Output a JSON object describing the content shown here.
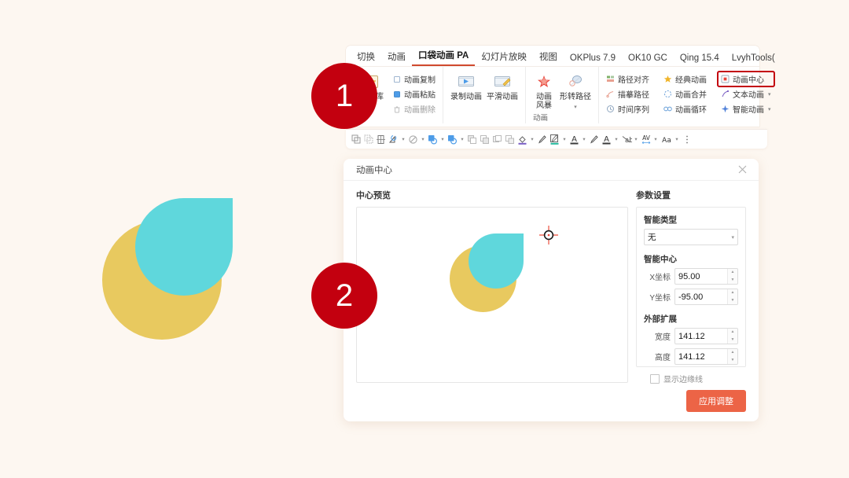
{
  "canvas": {
    "background_color": "#fdf7f1",
    "shapes": [
      {
        "name": "yellow-circle",
        "color": "#e8c95f",
        "type": "circle"
      },
      {
        "name": "cyan-teardrop",
        "color": "#5fd7dc",
        "type": "teardrop"
      }
    ]
  },
  "steps": [
    {
      "number": "1"
    },
    {
      "number": "2"
    }
  ],
  "ribbon": {
    "tabs": [
      {
        "label": "切换",
        "active": false
      },
      {
        "label": "动画",
        "active": false
      },
      {
        "label": "口袋动画 PA",
        "active": true
      },
      {
        "label": "幻灯片放映",
        "active": false
      },
      {
        "label": "视图",
        "active": false
      },
      {
        "label": "OKPlus 7.9",
        "active": false
      },
      {
        "label": "OK10 GC",
        "active": false
      },
      {
        "label": "Qing 15.4",
        "active": false
      },
      {
        "label": "LvyhTools(",
        "active": false
      }
    ],
    "group_title": "动画",
    "groups": [
      {
        "big_buttons": [
          {
            "label": "动画库",
            "icon": "animation-library-icon"
          }
        ],
        "items": [
          {
            "label": "动画复制",
            "icon": "copy-icon",
            "dim": false,
            "caret": false
          },
          {
            "label": "动画粘贴",
            "icon": "paste-icon",
            "dim": false,
            "caret": false
          },
          {
            "label": "动画删除",
            "icon": "delete-icon",
            "dim": true,
            "caret": false
          }
        ]
      },
      {
        "big_buttons": [
          {
            "label": "录制动画",
            "icon": "record-animation-icon"
          },
          {
            "label": "平滑动画",
            "icon": "smooth-animation-icon"
          }
        ],
        "items": []
      },
      {
        "big_buttons": [
          {
            "label": "动画\n风暴",
            "icon": "animation-storm-icon"
          },
          {
            "label": "形转路径",
            "icon": "shape-to-path-icon",
            "caret": true
          }
        ],
        "items": []
      },
      {
        "big_buttons": [],
        "items": [
          {
            "label": "路径对齐",
            "icon": "path-align-icon",
            "dim": false,
            "caret": false
          },
          {
            "label": "描摹路径",
            "icon": "trace-path-icon",
            "dim": false,
            "caret": false
          },
          {
            "label": "时间序列",
            "icon": "time-sequence-icon",
            "dim": false,
            "caret": false
          }
        ]
      },
      {
        "big_buttons": [],
        "items": [
          {
            "label": "经典动画",
            "icon": "classic-animation-icon",
            "dim": false,
            "caret": false
          },
          {
            "label": "动画合并",
            "icon": "merge-animation-icon",
            "dim": false,
            "caret": false
          },
          {
            "label": "动画循环",
            "icon": "loop-animation-icon",
            "dim": false,
            "caret": false
          }
        ]
      },
      {
        "big_buttons": [],
        "items": [
          {
            "label": "动画中心",
            "icon": "animation-center-icon",
            "dim": false,
            "caret": false,
            "highlight": true
          },
          {
            "label": "文本动画",
            "icon": "text-animation-icon",
            "dim": false,
            "caret": true
          },
          {
            "label": "智能动画",
            "icon": "smart-animation-icon",
            "dim": false,
            "caret": true
          }
        ]
      }
    ],
    "strip_icons": [
      {
        "name": "combine-shapes-icon",
        "caret": false
      },
      {
        "name": "split-shapes-icon",
        "caret": false
      },
      {
        "name": "align-objects-icon",
        "caret": false
      },
      {
        "name": "rotate-shape-icon",
        "caret": true
      },
      {
        "name": "no-fill-icon",
        "caret": true
      },
      {
        "name": "shape-fill-blue-icon",
        "caret": true
      },
      {
        "name": "shape-outline-blue-icon",
        "caret": true
      },
      {
        "name": "bring-forward-icon",
        "caret": false
      },
      {
        "name": "send-backward-icon",
        "caret": false
      },
      {
        "name": "bring-to-front-icon",
        "caret": false
      },
      {
        "name": "send-to-back-icon",
        "caret": false
      },
      {
        "name": "fill-color-purple-icon",
        "caret": true
      },
      {
        "name": "format-painter-icon",
        "caret": false
      },
      {
        "name": "outline-color-green-icon",
        "caret": true
      },
      {
        "name": "font-color-icon",
        "caret": true
      },
      {
        "name": "highlight-pen-icon",
        "caret": false
      },
      {
        "name": "text-color-icon",
        "caret": true
      },
      {
        "name": "clear-format-icon",
        "caret": true
      },
      {
        "name": "character-spacing-icon",
        "caret": true
      },
      {
        "name": "font-size-icon",
        "caret": true
      },
      {
        "name": "more-options-icon",
        "caret": false
      }
    ]
  },
  "dialog": {
    "title": "动画中心",
    "close_label": "✕",
    "preview_section_label": "中心预览",
    "params_section_label": "参数设置",
    "smart_type": {
      "label": "智能类型",
      "value": "无"
    },
    "smart_center": {
      "label": "智能中心",
      "fields": [
        {
          "label": "X坐标",
          "value": "95.00"
        },
        {
          "label": "Y坐标",
          "value": "-95.00"
        }
      ]
    },
    "outer_extend": {
      "label": "外部扩展",
      "fields": [
        {
          "label": "宽度",
          "value": "141.12"
        },
        {
          "label": "高度",
          "value": "141.12"
        }
      ]
    },
    "show_edge_line": {
      "label": "显示边缘线",
      "checked": false
    },
    "apply_button": "应用调整",
    "accent_color": "#ec6446"
  }
}
